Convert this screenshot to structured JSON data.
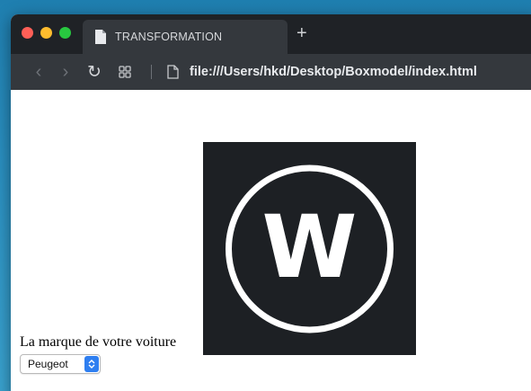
{
  "browser": {
    "tab_title": "TRANSFORMATION",
    "new_tab_label": "+",
    "url": "file:///Users/hkd/Desktop/Boxmodel/index.html"
  },
  "page": {
    "logo_letter": "W",
    "car_label": "La marque de votre voiture",
    "car_select": {
      "selected": "Peugeot"
    }
  },
  "colors": {
    "tabbar": "#1f2226",
    "toolbar": "#34383d",
    "logo_bg": "#1d2024",
    "select_accent": "#2e7ef0"
  }
}
